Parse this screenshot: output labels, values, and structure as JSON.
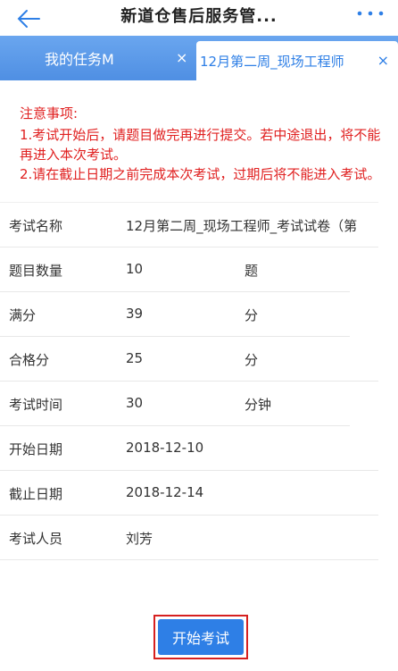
{
  "header": {
    "title": "新道仓售后服务管...",
    "back_icon": "arrow-left-icon",
    "more_icon": "more-dots-icon"
  },
  "tabs": [
    {
      "label": "我的任务M",
      "close": "×",
      "active": false
    },
    {
      "label": "12月第二周_现场工程师",
      "close": "×",
      "active": true
    }
  ],
  "notice": {
    "title": "注意事项:",
    "lines": [
      "1.考试开始后，请题目做完再进行提交。若中途退出，将不能再进入本次考试。",
      "2.请在截止日期之前完成本次考试，过期后将不能进入考试。"
    ]
  },
  "exam": {
    "rows": [
      {
        "label": "考试名称",
        "value": "12月第二周_现场工程师_考试试卷（第",
        "unit": ""
      },
      {
        "label": "题目数量",
        "value": "10",
        "unit": "题"
      },
      {
        "label": "满分",
        "value": "39",
        "unit": "分"
      },
      {
        "label": "合格分",
        "value": "25",
        "unit": "分"
      },
      {
        "label": "考试时间",
        "value": "30",
        "unit": "分钟"
      },
      {
        "label": "开始日期",
        "value": "2018-12-10",
        "unit": ""
      },
      {
        "label": "截止日期",
        "value": "2018-12-14",
        "unit": ""
      },
      {
        "label": "考试人员",
        "value": "刘芳",
        "unit": ""
      }
    ]
  },
  "actions": {
    "start_label": "开始考试"
  },
  "colors": {
    "primary": "#2e7fe6",
    "tabbar": "#5b9be8",
    "notice": "#e02020",
    "highlight": "#d62020"
  }
}
